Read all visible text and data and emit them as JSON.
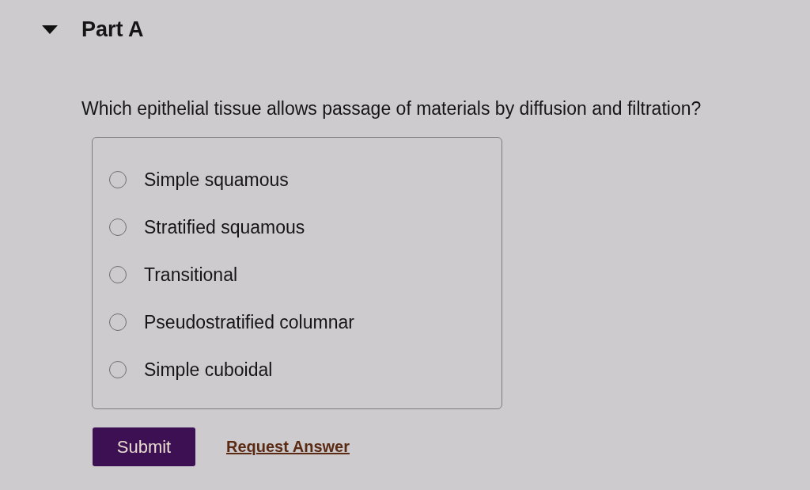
{
  "part": {
    "title": "Part A",
    "expanded": true
  },
  "question": "Which epithelial tissue allows passage of materials by diffusion and filtration?",
  "options": [
    {
      "label": "Simple squamous",
      "selected": false
    },
    {
      "label": "Stratified squamous",
      "selected": false
    },
    {
      "label": "Transitional",
      "selected": false
    },
    {
      "label": "Pseudostratified columnar",
      "selected": false
    },
    {
      "label": "Simple cuboidal",
      "selected": false
    }
  ],
  "submit_button": "Submit",
  "request_answer_link": "Request Answer"
}
